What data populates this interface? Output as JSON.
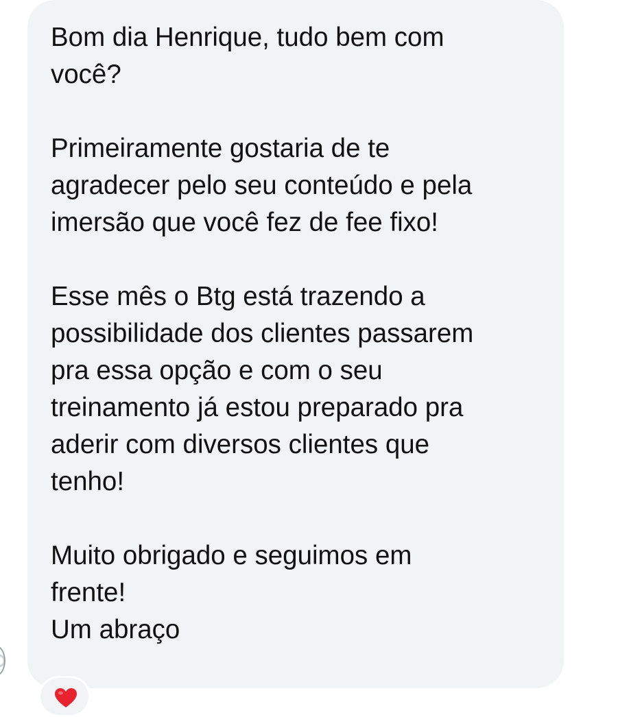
{
  "message": {
    "paragraphs": [
      [
        "Bom dia Henrique, tudo bem com",
        "você?"
      ],
      [
        "Primeiramente gostaria de te",
        "agradecer pelo seu conteúdo e pela",
        "imersão que você fez de fee fixo!"
      ],
      [
        "Esse mês o Btg está trazendo a",
        "possibilidade dos clientes passarem",
        "pra essa opção e com o seu",
        "treinamento já estou preparado pra",
        "aderir com diversos clientes que",
        "tenho!"
      ],
      [
        "Muito obrigado e seguimos em",
        "frente!"
      ],
      [
        "Um abraço"
      ]
    ]
  },
  "reaction": {
    "icon": "heart-icon",
    "color": "#e8222e"
  },
  "colors": {
    "bubble": "#f2f3f5",
    "text": "#111111",
    "background": "#ffffff"
  }
}
